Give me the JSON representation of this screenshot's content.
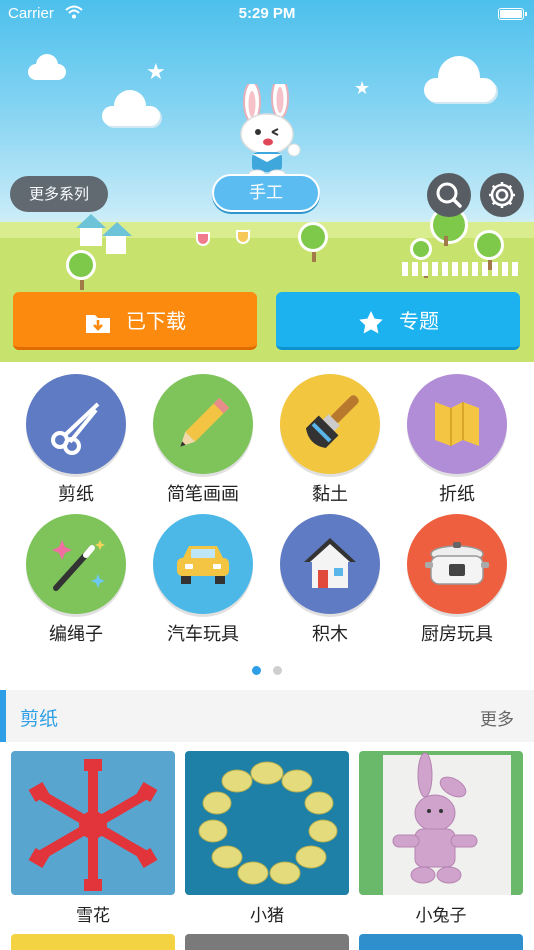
{
  "status_bar": {
    "carrier": "Carrier",
    "time": "5:29 PM"
  },
  "header": {
    "more_series": "更多系列",
    "current_category": "手工"
  },
  "actions": {
    "downloaded": "已下载",
    "topics": "专题"
  },
  "categories": [
    {
      "label": "剪纸",
      "color": "#5f7bc3",
      "icon": "scissors-icon"
    },
    {
      "label": "简笔画画",
      "color": "#7ec45b",
      "icon": "pencil-icon"
    },
    {
      "label": "黏土",
      "color": "#f2c63e",
      "icon": "paintbrush-icon"
    },
    {
      "label": "折纸",
      "color": "#b28dd7",
      "icon": "folded-paper-icon"
    },
    {
      "label": "编绳子",
      "color": "#7ec45b",
      "icon": "magic-wand-icon"
    },
    {
      "label": "汽车玩具",
      "color": "#4cb8e8",
      "icon": "toy-car-icon"
    },
    {
      "label": "积木",
      "color": "#5f7bc3",
      "icon": "house-icon"
    },
    {
      "label": "厨房玩具",
      "color": "#ee5f3f",
      "icon": "rice-cooker-icon"
    }
  ],
  "pager": {
    "pages": 2,
    "current": 1
  },
  "section": {
    "title": "剪纸",
    "more": "更多",
    "items": [
      {
        "caption": "雪花",
        "bg": "#58a5cf",
        "art": "red-snowflake-papercut"
      },
      {
        "caption": "小猪",
        "bg": "#1e7fa7",
        "art": "yellow-pig-ring-papercut"
      },
      {
        "caption": "小兔子",
        "bg": "#6ab86a",
        "art": "pink-bunny-papercut"
      }
    ]
  },
  "colors": {
    "accent": "#2e9fe6",
    "downloaded": "#fb8a0e",
    "topics": "#1cb1ef"
  }
}
